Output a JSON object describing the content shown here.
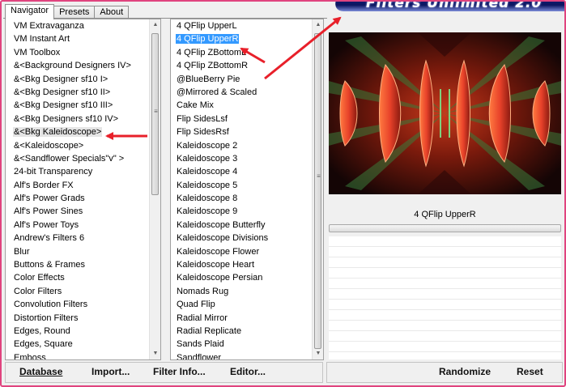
{
  "window": {
    "banner_title": "Filters Unlimited 2.0",
    "tabs": [
      {
        "label": "Navigator",
        "active": true
      },
      {
        "label": "Presets",
        "active": false
      },
      {
        "label": "About",
        "active": false
      }
    ]
  },
  "categories": {
    "items": [
      "VM Extravaganza",
      "VM Instant Art",
      "VM Toolbox",
      "&<Background Designers IV>",
      "&<Bkg Designer sf10 I>",
      "&<Bkg Designer sf10 II>",
      "&<Bkg Designer sf10 III>",
      "&<Bkg Designers sf10 IV>",
      "&<Bkg Kaleidoscope>",
      "&<Kaleidoscope>",
      "&<Sandflower Specials\"v\" >",
      "24-bit Transparency",
      "Alf's Border FX",
      "Alf's Power Grads",
      "Alf's Power Sines",
      "Alf's Power Toys",
      "Andrew's Filters 6",
      "Blur",
      "Buttons & Frames",
      "Color Effects",
      "Color Filters",
      "Convolution Filters",
      "Distortion Filters",
      "Edges, Round",
      "Edges, Square",
      "Emboss"
    ],
    "highlighted": "&<Bkg Kaleidoscope>"
  },
  "filters": {
    "items": [
      "4 QFlip UpperL",
      "4 QFlip UpperR",
      "4 QFlip ZBottomL",
      "4 QFlip ZBottomR",
      "@BlueBerry Pie",
      "@Mirrored & Scaled",
      "Cake Mix",
      "Flip SidesLsf",
      "Flip SidesRsf",
      "Kaleidoscope 2",
      "Kaleidoscope 3",
      "Kaleidoscope 4",
      "Kaleidoscope 5",
      "Kaleidoscope 8",
      "Kaleidoscope 9",
      "Kaleidoscope Butterfly",
      "Kaleidoscope Divisions",
      "Kaleidoscope Flower",
      "Kaleidoscope Heart",
      "Kaleidoscope Persian",
      "Nomads Rug",
      "Quad Flip",
      "Radial Mirror",
      "Radial Replicate",
      "Sands Plaid",
      "Sandflower"
    ],
    "selected": "4 QFlip UpperR"
  },
  "preview": {
    "filter_name": "4 QFlip UpperR"
  },
  "buttons": {
    "database": "Database",
    "import": "Import...",
    "filter_info": "Filter Info...",
    "editor": "Editor...",
    "randomize": "Randomize",
    "reset": "Reset"
  },
  "colors": {
    "frame": "#e0447f",
    "annotation_arrow": "#e8202a",
    "selection": "#3399ff"
  }
}
